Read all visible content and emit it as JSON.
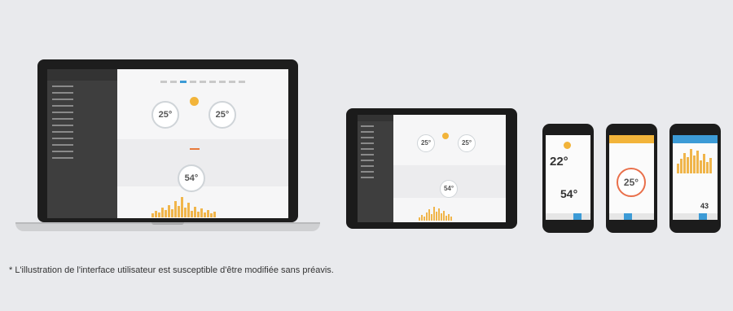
{
  "footnote": "* L'illustration de l'interface utilisateur est susceptible d'être modifiée sans préavis.",
  "laptop": {
    "setpoint_left": "25°",
    "setpoint_right": "25°",
    "humidity": "54°"
  },
  "tablet": {
    "setpoint_left": "25°",
    "setpoint_right": "25°",
    "humidity": "54°"
  },
  "phone1": {
    "temp": "22°",
    "humidity": "54°"
  },
  "phone2": {
    "temp": "25°"
  },
  "phone3": {
    "value": "43"
  },
  "colors": {
    "accent": "#3c9bd6",
    "sun": "#f2b43a",
    "chart": "#f0b54a"
  }
}
